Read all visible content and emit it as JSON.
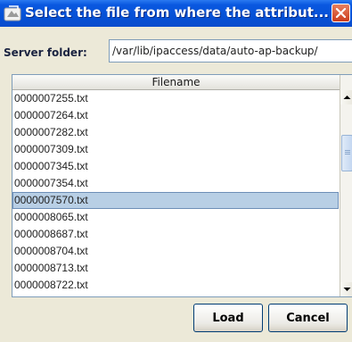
{
  "dialog": {
    "title": "Select the file from where the attribut...",
    "close_label": "X"
  },
  "server_folder": {
    "label": "Server folder:",
    "value": "/var/lib/ipaccess/data/auto-ap-backup/"
  },
  "file_table": {
    "column_header": "Filename",
    "files": [
      "0000007255.txt",
      "0000007264.txt",
      "0000007282.txt",
      "0000007309.txt",
      "0000007345.txt",
      "0000007354.txt",
      "0000007570.txt",
      "0000008065.txt",
      "0000008687.txt",
      "0000008704.txt",
      "0000008713.txt",
      "0000008722.txt"
    ],
    "selected_file": "0000007570.txt"
  },
  "buttons": {
    "load": "Load",
    "cancel": "Cancel"
  },
  "icons": {
    "title": "dialog-app-icon",
    "close": "close-icon",
    "scroll_up": "scroll-up-arrow-icon",
    "scroll_down": "scroll-down-arrow-icon"
  }
}
